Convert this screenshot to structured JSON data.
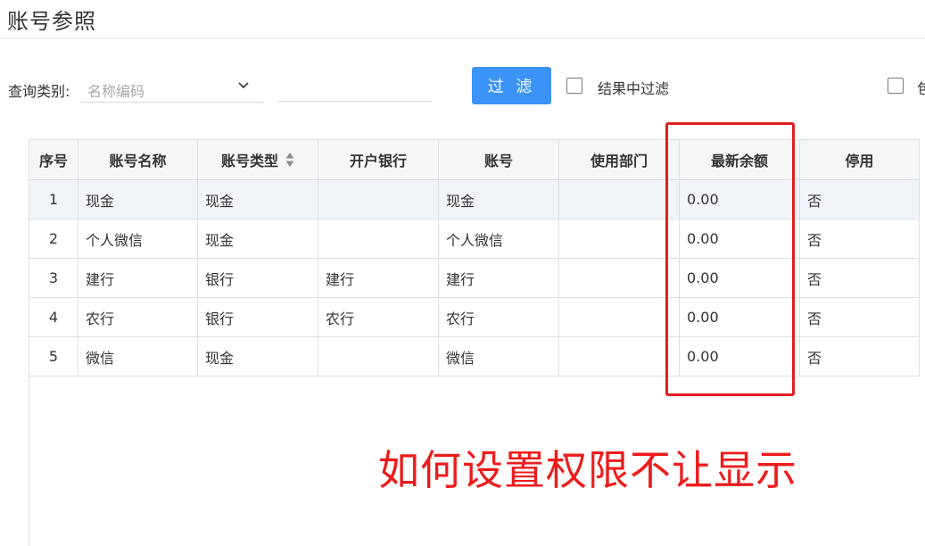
{
  "page": {
    "title": "账号参照"
  },
  "filter": {
    "category_label": "查询类别:",
    "category_placeholder": "名称编码",
    "query_value": "",
    "filter_button": "过 滤",
    "checkbox_1_label": "结果中过滤",
    "checkbox_1_checked": false,
    "checkbox_2_label": "包",
    "checkbox_2_checked": false
  },
  "table": {
    "columns": [
      "序号",
      "账号名称",
      "账号类型",
      "开户银行",
      "账号",
      "使用部门",
      "最新余额",
      "停用"
    ],
    "rows": [
      [
        "1",
        "现金",
        "现金",
        "",
        "现金",
        "",
        "0.00",
        "否"
      ],
      [
        "2",
        "个人微信",
        "现金",
        "",
        "个人微信",
        "",
        "0.00",
        "否"
      ],
      [
        "3",
        "建行",
        "银行",
        "建行",
        "建行",
        "",
        "0.00",
        "否"
      ],
      [
        "4",
        "农行",
        "银行",
        "农行",
        "农行",
        "",
        "0.00",
        "否"
      ],
      [
        "5",
        "微信",
        "现金",
        "",
        "微信",
        "",
        "0.00",
        "否"
      ]
    ],
    "selected_row": 0
  },
  "annotation": {
    "text": "如何设置权限不让显示",
    "color": "#ec1c1c"
  },
  "colors": {
    "primary": "#3b93f7",
    "highlight": "#e02020"
  },
  "icons": {
    "dropdown": "chevron-down-icon",
    "sort": "sort-icon"
  }
}
